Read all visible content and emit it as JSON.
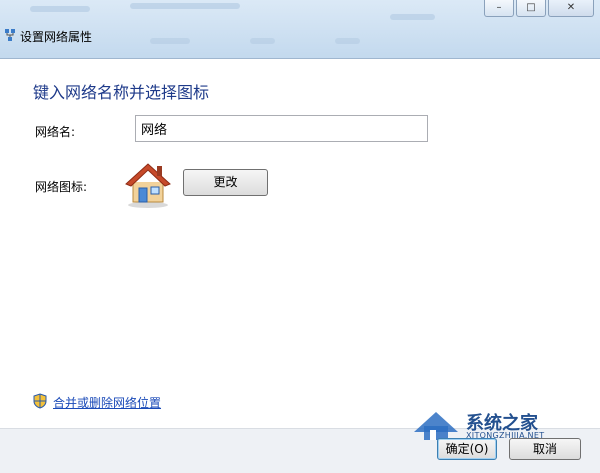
{
  "window": {
    "title": "设置网络属性",
    "minimize_symbol": "–",
    "maximize_symbol": "□",
    "close_symbol": "✕"
  },
  "heading": "键入网络名称并选择图标",
  "network_name": {
    "label": "网络名:",
    "value": "网络"
  },
  "network_icon": {
    "label": "网络图标:",
    "icon": "house-icon",
    "change_label": "更改"
  },
  "merge_link": {
    "label": "合并或删除网络位置",
    "icon": "shield-icon"
  },
  "buttons": {
    "ok_label": "确定(O)",
    "cancel_label": "取消"
  },
  "watermark": {
    "name": "系统之家",
    "url": "XITONGZHIJIA.NET"
  }
}
